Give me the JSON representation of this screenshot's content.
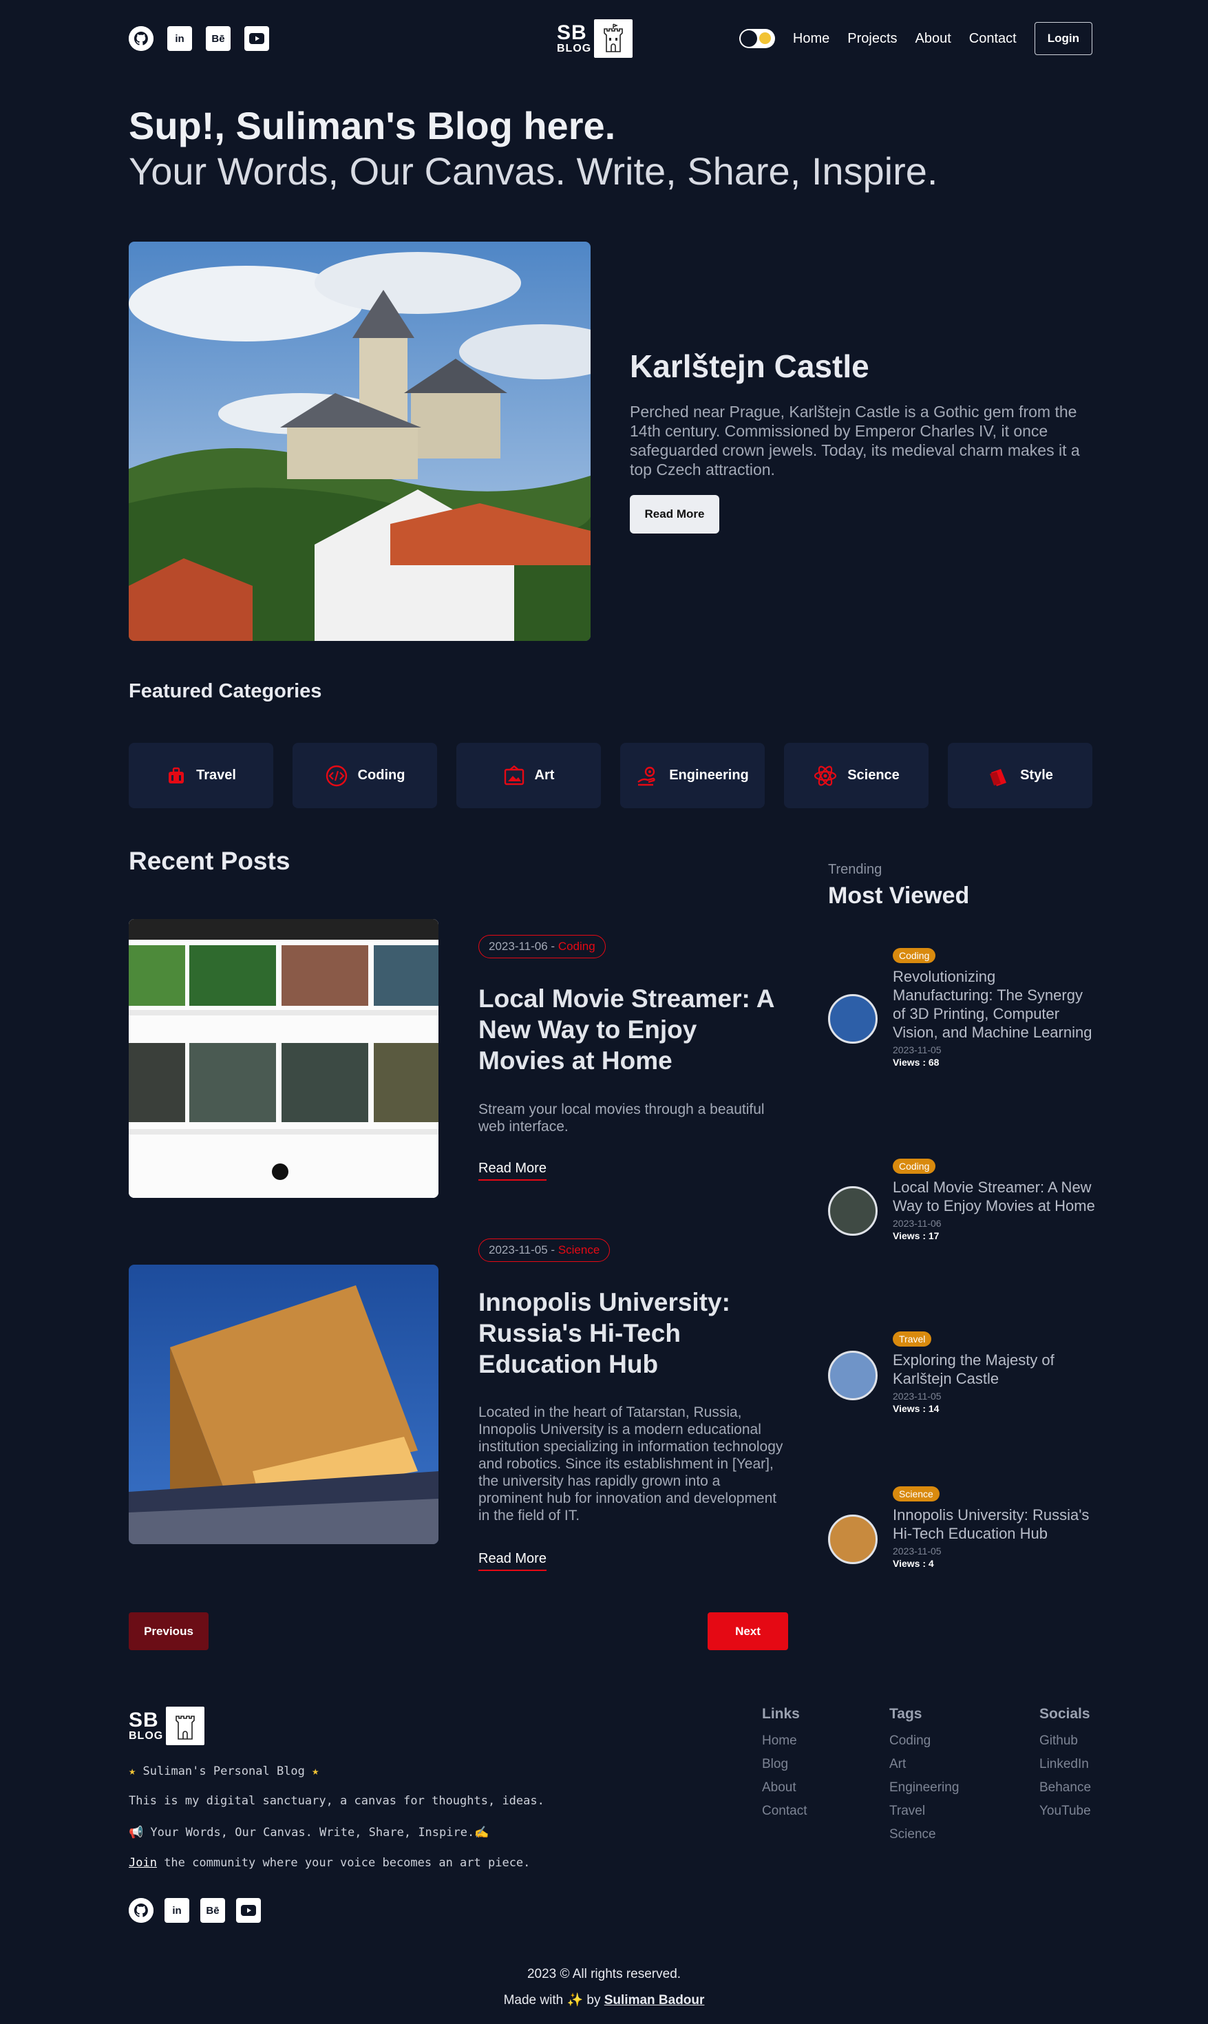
{
  "header": {
    "logo_top": "SB",
    "logo_bottom": "BLOG",
    "social_labels": {
      "linkedin": "in",
      "behance": "Bē"
    },
    "nav": [
      "Home",
      "Projects",
      "About",
      "Contact"
    ],
    "login_label": "Login"
  },
  "hero": {
    "title": "Sup!, Suliman's Blog here.",
    "subtitle": "Your Words, Our Canvas. Write, Share, Inspire."
  },
  "featured": {
    "title": "Karlštejn Castle",
    "description": "Perched near Prague, Karlštejn Castle is a Gothic gem from the 14th century. Commissioned by Emperor Charles IV, it once safeguarded crown jewels. Today, its medieval charm makes it a top Czech attraction.",
    "button_label": "Read More"
  },
  "categories": {
    "heading": "Featured Categories",
    "items": [
      {
        "label": "Travel",
        "icon": "suitcase-icon"
      },
      {
        "label": "Coding",
        "icon": "code-icon"
      },
      {
        "label": "Art",
        "icon": "art-frame-icon"
      },
      {
        "label": "Engineering",
        "icon": "hand-gear-icon"
      },
      {
        "label": "Science",
        "icon": "atom-icon"
      },
      {
        "label": "Style",
        "icon": "shopping-bag-icon"
      }
    ]
  },
  "recent": {
    "heading": "Recent Posts",
    "posts": [
      {
        "date": "2023-11-06",
        "sep": " - ",
        "category": "Coding",
        "title": "Local Movie Streamer: A New Way to Enjoy Movies at Home",
        "description": "Stream your local movies through a beautiful web interface.",
        "read_more": "Read More"
      },
      {
        "date": "2023-11-05",
        "sep": " - ",
        "category": "Science",
        "title": "Innopolis University: Russia's Hi-Tech Education Hub",
        "description": "Located in the heart of Tatarstan, Russia, Innopolis University is a modern educational institution specializing in information technology and robotics. Since its establishment in [Year], the university has rapidly grown into a prominent hub for innovation and development in the field of IT.",
        "read_more": "Read More"
      }
    ],
    "prev_label": "Previous",
    "next_label": "Next"
  },
  "sidebar": {
    "trending_label": "Trending",
    "heading": "Most Viewed",
    "items": [
      {
        "badge": "Coding",
        "title": "Revolutionizing Manufacturing: The Synergy of 3D Printing, Computer Vision, and Machine Learning",
        "date": "2023-11-05",
        "views": "Views : 68"
      },
      {
        "badge": "Coding",
        "title": "Local Movie Streamer: A New Way to Enjoy Movies at Home",
        "date": "2023-11-06",
        "views": "Views : 17"
      },
      {
        "badge": "Travel",
        "title": "Exploring the Majesty of Karlštejn Castle",
        "date": "2023-11-05",
        "views": "Views : 14"
      },
      {
        "badge": "Science",
        "title": "Innopolis University: Russia's Hi-Tech Education Hub",
        "date": "2023-11-05",
        "views": "Views : 4"
      }
    ]
  },
  "footer": {
    "line1": "Suliman's Personal Blog",
    "line2": "This is my digital sanctuary, a canvas for thoughts, ideas.",
    "line3": "📢 Your Words, Our Canvas. Write, Share, Inspire.✍️",
    "join_link": "Join",
    "line4_rest": " the community where your voice becomes an art piece.",
    "columns": {
      "links": {
        "title": "Links",
        "items": [
          "Home",
          "Blog",
          "About",
          "Contact"
        ]
      },
      "tags": {
        "title": "Tags",
        "items": [
          "Coding",
          "Art",
          "Engineering",
          "Travel",
          "Science"
        ]
      },
      "socials": {
        "title": "Socials",
        "items": [
          "Github",
          "LinkedIn",
          "Behance",
          "YouTube"
        ]
      }
    },
    "copyright": "2023 © All rights reserved.",
    "made_with": "Made with ✨ by ",
    "author": "Suliman Badour"
  },
  "colors": {
    "background": "#0e1525",
    "accent": "#e50914",
    "card": "#151f38",
    "badge": "#d98a0e"
  }
}
